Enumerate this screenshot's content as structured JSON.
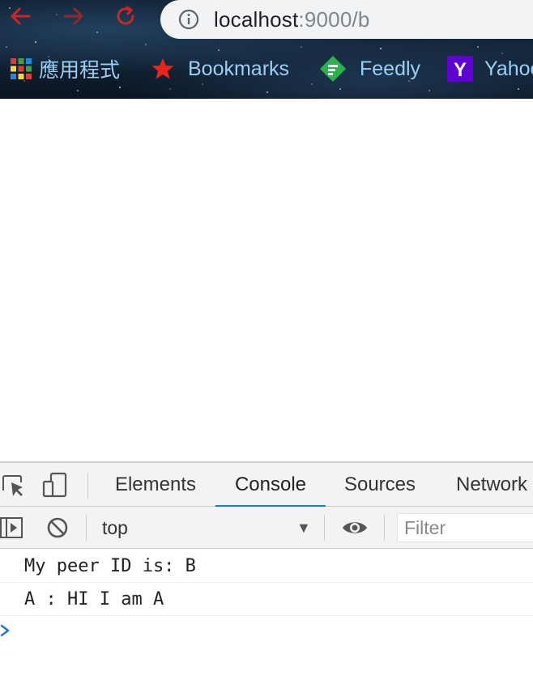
{
  "browser": {
    "url_host": "localhost",
    "url_path": ":9000/b",
    "bookmarks": [
      {
        "label": "應用程式",
        "icon": "apps-grid-icon"
      },
      {
        "label": "Bookmarks",
        "icon": "star-icon"
      },
      {
        "label": "Feedly",
        "icon": "feedly-icon"
      },
      {
        "label": "Yahoo",
        "icon": "yahoo-icon"
      }
    ]
  },
  "devtools": {
    "tabs": [
      "Elements",
      "Console",
      "Sources",
      "Network"
    ],
    "active_tab": "Console",
    "context": "top",
    "filter_placeholder": "Filter",
    "logs": [
      "My peer ID is: B",
      "A : HI I am A"
    ]
  },
  "colors": {
    "accent": "#1a73e8",
    "bookmark_text": "#9ad0f5",
    "nav_red": "#c62828"
  }
}
